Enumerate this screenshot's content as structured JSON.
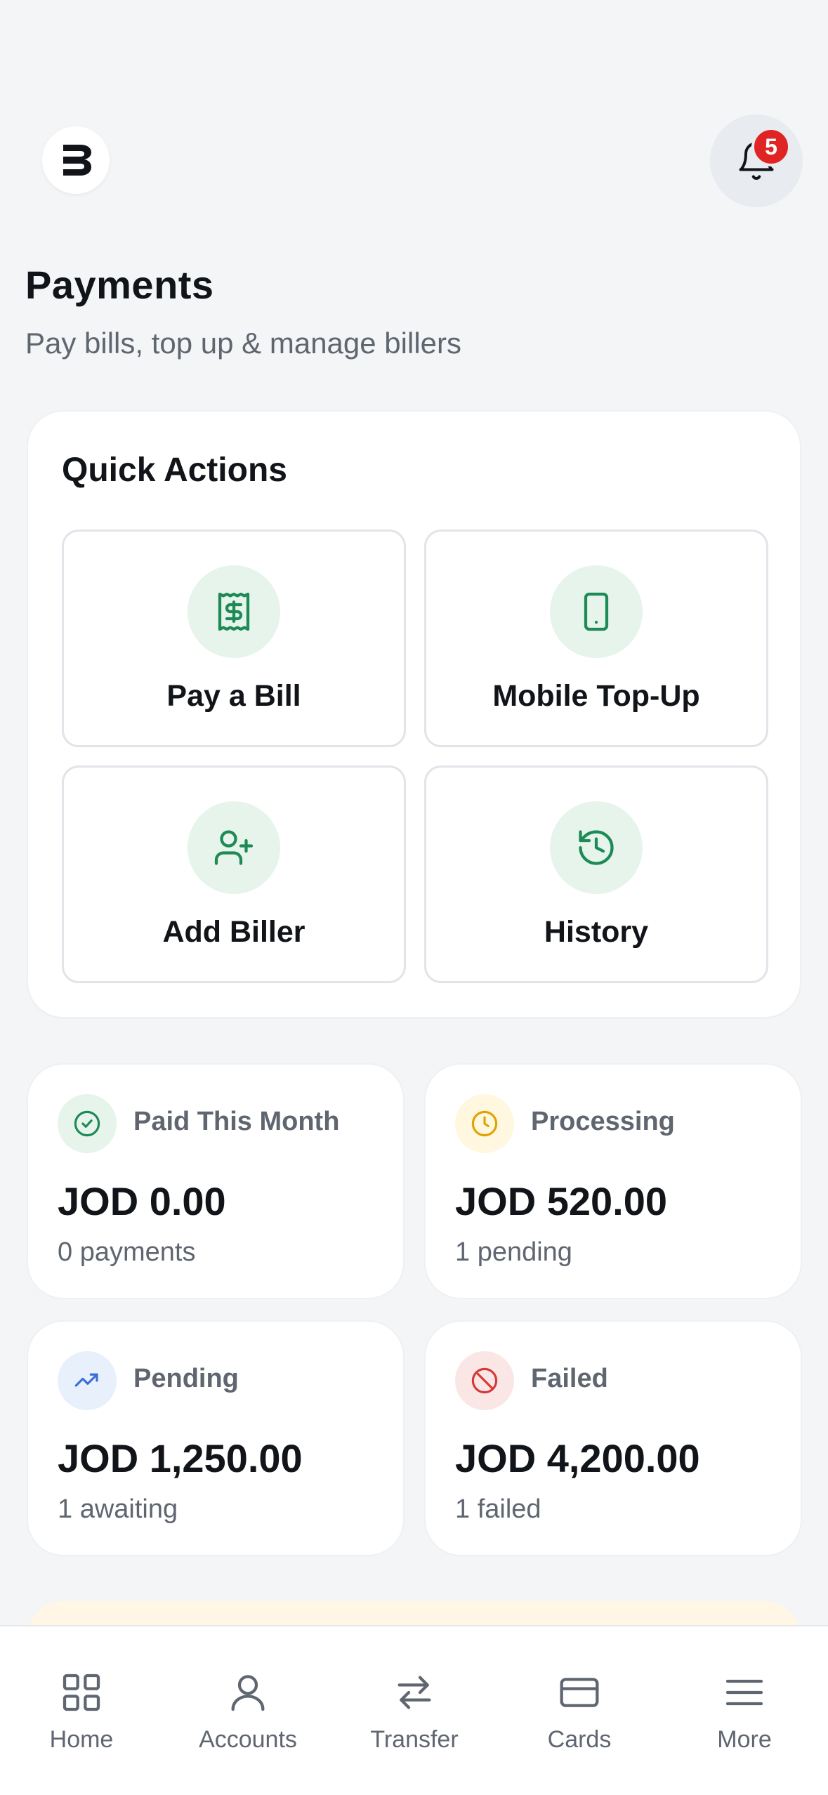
{
  "header": {
    "notification_count": "5"
  },
  "page": {
    "title": "Payments",
    "subtitle": "Pay bills, top up & manage billers"
  },
  "quick_actions": {
    "title": "Quick Actions",
    "items": [
      {
        "label": "Pay a Bill",
        "icon": "receipt-dollar-icon"
      },
      {
        "label": "Mobile Top-Up",
        "icon": "smartphone-icon"
      },
      {
        "label": "Add Biller",
        "icon": "user-plus-icon"
      },
      {
        "label": "History",
        "icon": "history-icon"
      }
    ]
  },
  "stats": [
    {
      "label": "Paid This Month",
      "amount": "JOD 0.00",
      "sub": "0 payments",
      "icon": "check-circle-icon",
      "color": "#1e8a55",
      "bg": "#e6f4ec"
    },
    {
      "label": "Processing",
      "amount": "JOD 520.00",
      "sub": "1 pending",
      "icon": "clock-icon",
      "color": "#e0a400",
      "bg": "#fff7df"
    },
    {
      "label": "Pending",
      "amount": "JOD 1,250.00",
      "sub": "1 awaiting",
      "icon": "trending-up-icon",
      "color": "#3b6fd8",
      "bg": "#e8f0fb"
    },
    {
      "label": "Failed",
      "amount": "JOD 4,200.00",
      "sub": "1 failed",
      "icon": "ban-icon",
      "color": "#d33a3a",
      "bg": "#fbe6e6"
    }
  ],
  "nav": {
    "items": [
      {
        "label": "Home",
        "icon": "grid-icon"
      },
      {
        "label": "Accounts",
        "icon": "user-icon"
      },
      {
        "label": "Transfer",
        "icon": "transfer-arrows-icon"
      },
      {
        "label": "Cards",
        "icon": "card-icon"
      },
      {
        "label": "More",
        "icon": "menu-icon"
      }
    ]
  },
  "colors": {
    "accent": "#1e8a55",
    "badge": "#e02424",
    "background": "#f4f5f7"
  }
}
